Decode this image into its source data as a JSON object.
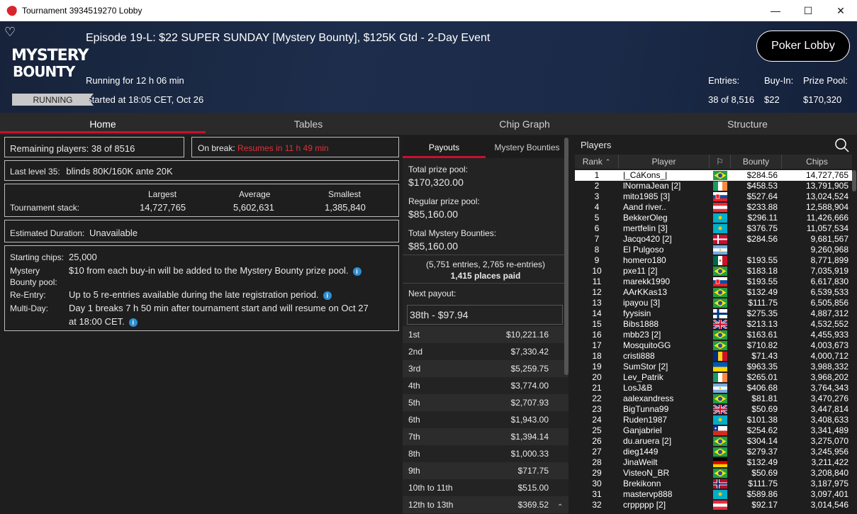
{
  "window": {
    "title": "Tournament 3934519270 Lobby",
    "controls": [
      "—",
      "☐",
      "✕"
    ]
  },
  "header": {
    "title": "Episode 19-L: $22 SUPER SUNDAY [Mystery Bounty], $125K Gtd - 2-Day Event",
    "logo_line1": "MYSTERY",
    "logo_line2": "BOUNTY",
    "running_for": "Running for 12 h 06 min",
    "started": "Started at 18:05 CET, Oct 26",
    "status": "RUNNING",
    "lobby_button": "Poker Lobby",
    "entries_label": "Entries:",
    "entries_value": "38 of 8,516",
    "buyin_label": "Buy-In:",
    "buyin_value": "$22",
    "prize_label": "Prize Pool:",
    "prize_value": "$170,320"
  },
  "tabs": [
    "Home",
    "Tables",
    "Chip Graph",
    "Structure"
  ],
  "home": {
    "remaining": "Remaining players: 38 of 8516",
    "on_break_label": "On break:",
    "on_break_value": "Resumes in 11 h 49 min",
    "last_level_label": "Last level 35:",
    "last_level_value": "blinds 80K/160K ante 20K",
    "stack_label": "Tournament stack:",
    "stack_headers": [
      "Largest",
      "Average",
      "Smallest"
    ],
    "stack_values": [
      "14,727,765",
      "5,602,631",
      "1,385,840"
    ],
    "duration_label": "Estimated Duration:",
    "duration_value": "Unavailable",
    "starting_label": "Starting chips:",
    "starting_value": "25,000",
    "mystery_label_1": "Mystery",
    "mystery_label_2": "Bounty pool:",
    "mystery_value": "$10 from each buy-in will be added to the Mystery Bounty prize pool.",
    "reentry_label": "Re-Entry:",
    "reentry_value": "Up to 5 re-entries available during the late registration period.",
    "multiday_label": "Multi-Day:",
    "multiday_value_1": "Day 1 breaks 7 h 50 min after tournament start and will resume on Oct 27",
    "multiday_value_2": "at 18:00 CET."
  },
  "payouts": {
    "tabs": [
      "Payouts",
      "Mystery Bounties"
    ],
    "total_label": "Total prize pool:",
    "total_value": "$170,320.00",
    "regular_label": "Regular prize pool:",
    "regular_value": "$85,160.00",
    "mystery_label": "Total Mystery Bounties:",
    "mystery_value": "$85,160.00",
    "entries_note": "(5,751 entries, 2,765 re-entries)",
    "places_paid": "1,415 places paid",
    "next_label": "Next payout:",
    "next_value": "38th - $97.94",
    "rows": [
      [
        "1st",
        "$10,221.16"
      ],
      [
        "2nd",
        "$7,330.42"
      ],
      [
        "3rd",
        "$5,259.75"
      ],
      [
        "4th",
        "$3,774.00"
      ],
      [
        "5th",
        "$2,707.93"
      ],
      [
        "6th",
        "$1,943.00"
      ],
      [
        "7th",
        "$1,394.14"
      ],
      [
        "8th",
        "$1,000.33"
      ],
      [
        "9th",
        "$717.75"
      ],
      [
        "10th to 11th",
        "$515.00"
      ],
      [
        "12th to 13th",
        "$369.52"
      ]
    ]
  },
  "players": {
    "title": "Players",
    "columns": [
      "Rank",
      "Player",
      "Bounty",
      "Chips"
    ],
    "rows": [
      {
        "rank": "1",
        "name": "|_CáKons_|",
        "flag": "br",
        "bounty": "$284.56",
        "chips": "14,727,765"
      },
      {
        "rank": "2",
        "name": "lNormaJean [2]",
        "flag": "ie",
        "bounty": "$458.53",
        "chips": "13,791,905"
      },
      {
        "rank": "3",
        "name": "mito1985 [3]",
        "flag": "sk",
        "bounty": "$527.64",
        "chips": "13,024,524"
      },
      {
        "rank": "4",
        "name": "Aand river..",
        "flag": "at",
        "bounty": "$233.88",
        "chips": "12,588,904"
      },
      {
        "rank": "5",
        "name": "BekkerOleg",
        "flag": "kz",
        "bounty": "$296.11",
        "chips": "11,426,666"
      },
      {
        "rank": "6",
        "name": "mertfelin [3]",
        "flag": "kz",
        "bounty": "$376.75",
        "chips": "11,057,534"
      },
      {
        "rank": "7",
        "name": "Jacqo420 [2]",
        "flag": "dk",
        "bounty": "$284.56",
        "chips": "9,681,567"
      },
      {
        "rank": "8",
        "name": "El Pulgoso",
        "flag": "ar",
        "bounty": "",
        "chips": "9,260,968"
      },
      {
        "rank": "9",
        "name": "homero180",
        "flag": "mx",
        "bounty": "$193.55",
        "chips": "8,771,899"
      },
      {
        "rank": "10",
        "name": "pxe11 [2]",
        "flag": "br",
        "bounty": "$183.18",
        "chips": "7,035,919"
      },
      {
        "rank": "11",
        "name": "marekk1990",
        "flag": "sk",
        "bounty": "$193.55",
        "chips": "6,617,830"
      },
      {
        "rank": "12",
        "name": "AArKKas13",
        "flag": "br",
        "bounty": "$132.49",
        "chips": "6,539,533"
      },
      {
        "rank": "13",
        "name": "ipayou [3]",
        "flag": "br",
        "bounty": "$111.75",
        "chips": "6,505,856"
      },
      {
        "rank": "14",
        "name": "fyysisin",
        "flag": "fi",
        "bounty": "$275.35",
        "chips": "4,887,312"
      },
      {
        "rank": "15",
        "name": "Bibs1888",
        "flag": "gb",
        "bounty": "$213.13",
        "chips": "4,532,552"
      },
      {
        "rank": "16",
        "name": "mbb23 [2]",
        "flag": "br",
        "bounty": "$163.61",
        "chips": "4,455,933"
      },
      {
        "rank": "17",
        "name": "MosquitoGG",
        "flag": "br",
        "bounty": "$710.82",
        "chips": "4,003,673"
      },
      {
        "rank": "18",
        "name": "cristi888",
        "flag": "ro",
        "bounty": "$71.43",
        "chips": "4,000,712"
      },
      {
        "rank": "19",
        "name": "SumStor [2]",
        "flag": "ua",
        "bounty": "$963.35",
        "chips": "3,988,332"
      },
      {
        "rank": "20",
        "name": "Lev_Patrik",
        "flag": "ie",
        "bounty": "$265.01",
        "chips": "3,968,202"
      },
      {
        "rank": "21",
        "name": "LosJ&B",
        "flag": "ar",
        "bounty": "$406.68",
        "chips": "3,764,343"
      },
      {
        "rank": "22",
        "name": "aalexandress",
        "flag": "br",
        "bounty": "$81.81",
        "chips": "3,470,276"
      },
      {
        "rank": "23",
        "name": "BigTunna99",
        "flag": "gb",
        "bounty": "$50.69",
        "chips": "3,447,814"
      },
      {
        "rank": "24",
        "name": "Ruden1987",
        "flag": "kz",
        "bounty": "$101.38",
        "chips": "3,408,633"
      },
      {
        "rank": "25",
        "name": "Ganjabriel",
        "flag": "cl",
        "bounty": "$254.62",
        "chips": "3,341,489"
      },
      {
        "rank": "26",
        "name": "du.aruera [2]",
        "flag": "br",
        "bounty": "$304.14",
        "chips": "3,275,070"
      },
      {
        "rank": "27",
        "name": "dieg1449",
        "flag": "br",
        "bounty": "$279.37",
        "chips": "3,245,956"
      },
      {
        "rank": "28",
        "name": "JinaWeilt",
        "flag": "de",
        "bounty": "$132.49",
        "chips": "3,211,422"
      },
      {
        "rank": "29",
        "name": "VisteoN_BR",
        "flag": "br",
        "bounty": "$50.69",
        "chips": "3,208,840"
      },
      {
        "rank": "30",
        "name": "Brekikonn",
        "flag": "no",
        "bounty": "$111.75",
        "chips": "3,187,975"
      },
      {
        "rank": "31",
        "name": "mastervp888",
        "flag": "kz",
        "bounty": "$589.86",
        "chips": "3,097,401"
      },
      {
        "rank": "32",
        "name": "crppppp [2]",
        "flag": "at",
        "bounty": "$92.17",
        "chips": "3,014,546"
      }
    ]
  },
  "colors": {
    "accent": "#c8102e",
    "header_bg": "#1b2a46",
    "link_red": "#e0303a"
  }
}
